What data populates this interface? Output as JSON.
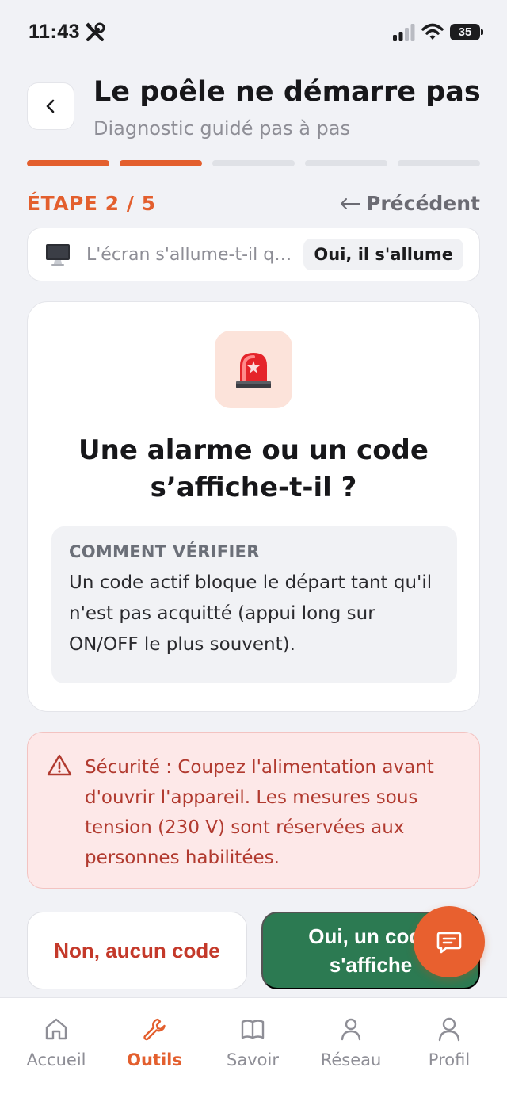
{
  "status_bar": {
    "time": "11:43",
    "battery": "35"
  },
  "header": {
    "title": "Le poêle ne démarre pas",
    "subtitle": "Diagnostic guidé pas à pas"
  },
  "progress": {
    "current_step": 2,
    "total_steps": 5,
    "step_label": "ÉTAPE 2 / 5",
    "previous_label": "Précédent"
  },
  "previous_answer": {
    "icon": "monitor-icon",
    "question": "L'écran s'allume-t-il quand vous appuyez sur ON/OFF ?",
    "answer": "Oui, il s'allume"
  },
  "question": {
    "icon": "alarm-light-icon",
    "title": "Une alarme ou un code s’affiche-t-il ?",
    "howto_heading": "COMMENT VÉRIFIER",
    "howto_text": "Un code actif bloque le départ tant qu'il n'est pas acquitté (appui long sur ON/OFF le plus souvent)."
  },
  "safety": {
    "icon": "warning-icon",
    "text": "Sécurité : Coupez l'alimentation avant d'ouvrir l'appareil. Les mesures sous tension (230 V) sont réservées aux personnes habilitées."
  },
  "answers": {
    "no_label": "Non, aucun code",
    "yes_label": "Oui, un code s'affiche"
  },
  "tab_bar": {
    "items": [
      {
        "label": "Accueil",
        "icon": "home-icon"
      },
      {
        "label": "Outils",
        "icon": "wrench-icon"
      },
      {
        "label": "Savoir",
        "icon": "book-icon"
      },
      {
        "label": "Réseau",
        "icon": "person-icon"
      },
      {
        "label": "Profil",
        "icon": "profile-icon"
      }
    ],
    "active": "Outils"
  },
  "colors": {
    "accent": "#e35f2e",
    "success": "#2c7a52",
    "danger": "#c4392a",
    "danger_bg": "#fde8e8"
  }
}
